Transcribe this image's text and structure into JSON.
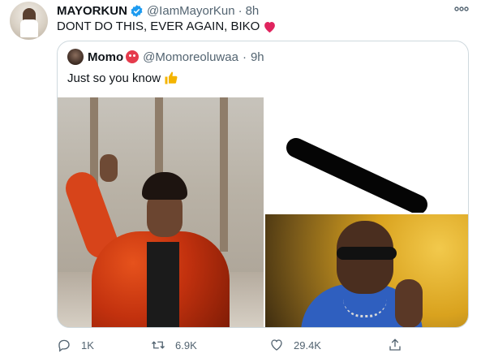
{
  "tweet": {
    "author_name": "MAYORKUN",
    "author_handle": "@IamMayorKun",
    "separator": "·",
    "time": "8h",
    "text": "DONT DO THIS, EVER AGAIN, BIKO",
    "heart_emoji": "heart-emoji-icon"
  },
  "quote": {
    "author_name": "Momo",
    "author_handle": "@Momoreoluwaa",
    "separator": "·",
    "time": "9h",
    "text": "Just so you know",
    "emoji_after_name": "red-face-emoji-icon",
    "emoji_after_text": "thumbs-up-emoji-icon"
  },
  "actions": {
    "reply_count": "1K",
    "retweet_count": "6.9K",
    "like_count": "29.4K"
  },
  "colors": {
    "text_primary": "#0f1419",
    "text_secondary": "#536471",
    "border": "#cfd9de",
    "verified_blue": "#1d9bf0",
    "heart_red": "#e0245e"
  }
}
